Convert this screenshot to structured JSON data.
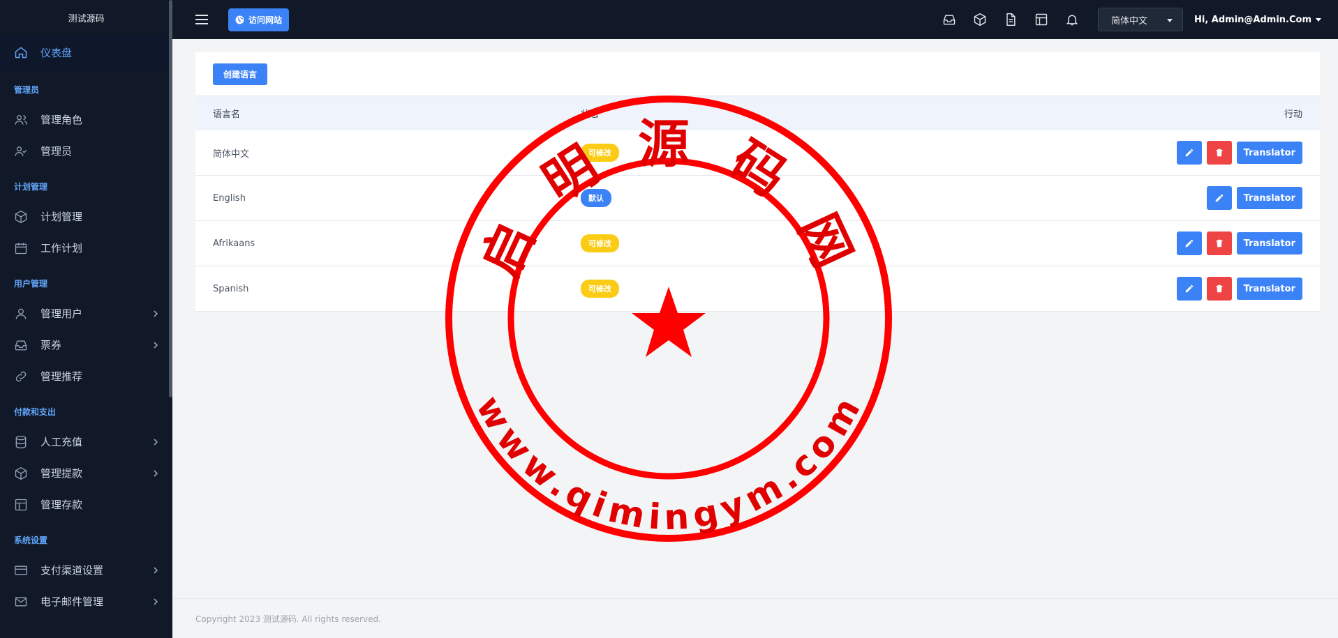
{
  "sidebar": {
    "brand": "测试源码",
    "dashboard": "仪表盘",
    "sections": {
      "admin": "管理员",
      "plan": "计划管理",
      "user": "用户管理",
      "payment": "付款和支出",
      "system": "系统设置"
    },
    "items": {
      "manage_roles": "管理角色",
      "admins": "管理员",
      "plan_manage": "计划管理",
      "work_plan": "工作计划",
      "manage_users": "管理用户",
      "tickets": "票券",
      "manage_referrals": "管理推荐",
      "manual_recharge": "人工充值",
      "manage_withdrawals": "管理提款",
      "manage_deposits": "管理存款",
      "payment_channel": "支付渠道设置",
      "email_manage": "电子邮件管理"
    }
  },
  "topbar": {
    "visit_site": "访问网站",
    "language": "简体中文",
    "user": "Hi, Admin@Admin.Com"
  },
  "content": {
    "create_button": "创建语言",
    "headers": {
      "name": "语言名",
      "status": "状态",
      "action": "行动"
    },
    "rows": [
      {
        "name": "简体中文",
        "status": "可修改",
        "status_color": "#facc15",
        "deletable": true
      },
      {
        "name": "English",
        "status": "默认",
        "status_color": "#3b82f6",
        "deletable": false
      },
      {
        "name": "Afrikaans",
        "status": "可修改",
        "status_color": "#facc15",
        "deletable": true
      },
      {
        "name": "Spanish",
        "status": "可修改",
        "status_color": "#facc15",
        "deletable": true
      }
    ],
    "translator_label": "Translator"
  },
  "footer": {
    "copyright": "Copyright 2023 测试源码. All rights reserved."
  },
  "colors": {
    "accent": "#3b82f6",
    "danger": "#ef4444",
    "warning": "#facc15",
    "sidebar": "#111827",
    "stamp": "#ff0000"
  },
  "watermark": {
    "top_text": "启 明 源 码 网",
    "bottom_text": "www.qimingym.com"
  }
}
